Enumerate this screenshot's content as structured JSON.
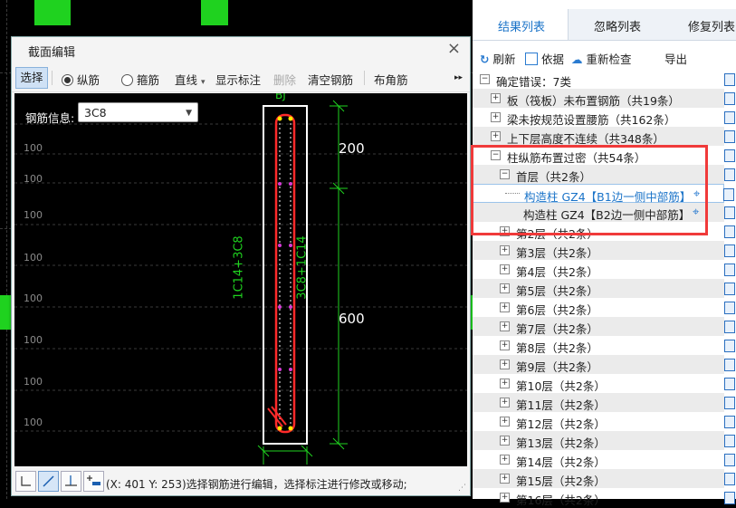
{
  "dialog": {
    "title": "截面编辑",
    "close": "×",
    "toolbar": {
      "select": "选择",
      "longitudinal": "纵筋",
      "stirrup": "箍筋",
      "line": "直线",
      "line_arrow": "▾",
      "show_label": "显示标注",
      "delete": "删除",
      "clear_rebar": "清空钢筋",
      "corner_rebar": "布角筋",
      "more": "▸▸"
    },
    "rebar_info_label": "钢筋信息:",
    "rebar_info_value": "3C8",
    "canvas": {
      "section_name": "BJ",
      "dim_top": "200",
      "dim_bottom": "600",
      "left_rebar": "1C14+3C8",
      "right_rebar": "3C8+1C14",
      "grid_label": "100"
    },
    "status": "(X: 401 Y: 253)选择钢筋进行编辑，选择标注进行修改或移动;"
  },
  "panel": {
    "tabs": [
      "结果列表",
      "忽略列表",
      "修复列表"
    ],
    "toolbar": {
      "refresh": "刷新",
      "basis": "依据",
      "recheck": "重新检查",
      "export": "导出"
    },
    "tree": [
      {
        "label": "确定错误：7类",
        "level": 0,
        "exp": "−"
      },
      {
        "label": "板（筏板）未布置钢筋（共19条）",
        "level": 1,
        "exp": "+"
      },
      {
        "label": "梁未按规范设置腰筋（共162条）",
        "level": 1,
        "exp": "+"
      },
      {
        "label": "上下层高度不连续（共348条）",
        "level": 1,
        "exp": "+"
      },
      {
        "label": "柱纵筋布置过密（共54条）",
        "level": 1,
        "exp": "−"
      },
      {
        "label": "首层（共2条）",
        "level": 2,
        "exp": "−"
      },
      {
        "label": "构造柱 GZ4【B1边一侧中部筋】",
        "level": 3,
        "exp": ""
      },
      {
        "label": "构造柱 GZ4【B2边一侧中部筋】",
        "level": 3,
        "exp": ""
      },
      {
        "label": "第2层（共2条）",
        "level": 2,
        "exp": "+"
      },
      {
        "label": "第3层（共2条）",
        "level": 2,
        "exp": "+"
      },
      {
        "label": "第4层（共2条）",
        "level": 2,
        "exp": "+"
      },
      {
        "label": "第5层（共2条）",
        "level": 2,
        "exp": "+"
      },
      {
        "label": "第6层（共2条）",
        "level": 2,
        "exp": "+"
      },
      {
        "label": "第7层（共2条）",
        "level": 2,
        "exp": "+"
      },
      {
        "label": "第8层（共2条）",
        "level": 2,
        "exp": "+"
      },
      {
        "label": "第9层（共2条）",
        "level": 2,
        "exp": "+"
      },
      {
        "label": "第10层（共2条）",
        "level": 2,
        "exp": "+"
      },
      {
        "label": "第11层（共2条）",
        "level": 2,
        "exp": "+"
      },
      {
        "label": "第12层（共2条）",
        "level": 2,
        "exp": "+"
      },
      {
        "label": "第13层（共2条）",
        "level": 2,
        "exp": "+"
      },
      {
        "label": "第14层（共2条）",
        "level": 2,
        "exp": "+"
      },
      {
        "label": "第15层（共2条）",
        "level": 2,
        "exp": "+"
      },
      {
        "label": "第16层（共2条）",
        "level": 2,
        "exp": "+"
      }
    ]
  },
  "colors": {
    "accent": "#1a73c8",
    "highlight": "#f03a3a",
    "cad_green": "#1fd21f",
    "rebar_red": "#ff2a2a"
  }
}
